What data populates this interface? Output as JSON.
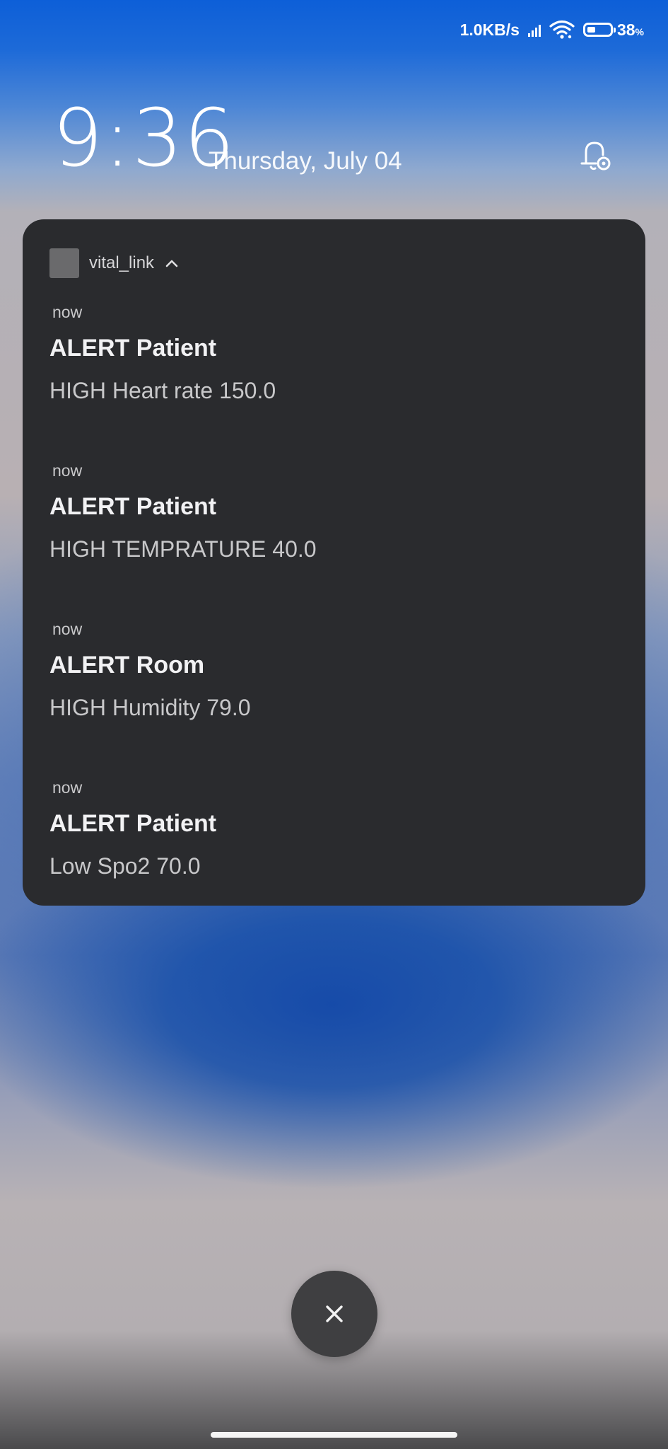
{
  "status_bar": {
    "network_speed": "1.0KB/s",
    "battery_percent": "38",
    "battery_unit": "%",
    "battery_level": 0.38,
    "icons": [
      "signal-icon",
      "wifi-icon",
      "battery-icon"
    ]
  },
  "lockscreen": {
    "time": "9:36",
    "date": "Thursday, July 04",
    "settings_icon": "notification-settings-icon"
  },
  "notification_group": {
    "app_name": "vital_link",
    "app_icon": "app-icon",
    "collapse_icon": "chevron-up-icon",
    "items": [
      {
        "time": "now",
        "title": "ALERT Patient",
        "body": "HIGH Heart rate 150.0"
      },
      {
        "time": "now",
        "title": "ALERT Patient",
        "body": "HIGH TEMPRATURE 40.0"
      },
      {
        "time": "now",
        "title": "ALERT Room",
        "body": "HIGH Humidity 79.0"
      },
      {
        "time": "now",
        "title": "ALERT Patient",
        "body": "Low Spo2 70.0"
      }
    ]
  },
  "controls": {
    "close_icon": "close-icon"
  },
  "colors": {
    "card_background": "#2a2b2e",
    "close_button_background": "#3f3f41",
    "wallpaper_top": "#0d5fd8",
    "wallpaper_accent": "#1248a8"
  }
}
